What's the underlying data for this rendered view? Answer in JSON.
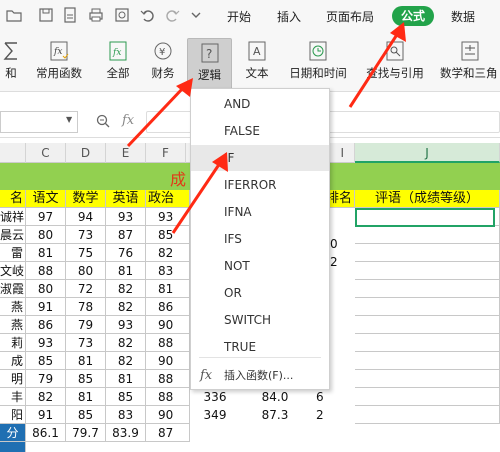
{
  "toolbar": {
    "tabs": [
      "开始",
      "插入",
      "页面布局",
      "公式",
      "数据"
    ],
    "active_tab": "公式",
    "active_color": "#22a34a"
  },
  "ribbon": {
    "buttons": [
      "和",
      "常用函数",
      "全部",
      "财务",
      "逻辑",
      "文本",
      "日期和时间",
      "查找与引用",
      "数学和三角"
    ],
    "pressed": "逻辑"
  },
  "formula_bar": {
    "fx_label": "fx",
    "value": ""
  },
  "sheet": {
    "columns": [
      "C",
      "D",
      "E",
      "F",
      "I",
      "J"
    ],
    "title_char": "成",
    "header_row": [
      "名",
      "语文",
      "数学",
      "英语",
      "政治",
      "排名",
      "评语（成绩等级）"
    ],
    "rows": [
      [
        "诚祥",
        "97",
        "94",
        "93",
        "93"
      ],
      [
        "晨云",
        "80",
        "73",
        "87",
        "85"
      ],
      [
        "雷",
        "81",
        "75",
        "76",
        "82"
      ],
      [
        "文岐",
        "88",
        "80",
        "81",
        "83"
      ],
      [
        "淑霞",
        "80",
        "72",
        "82",
        "81"
      ],
      [
        "燕",
        "91",
        "78",
        "82",
        "86"
      ],
      [
        "燕",
        "86",
        "79",
        "93",
        "90"
      ],
      [
        "莉",
        "93",
        "73",
        "82",
        "88"
      ],
      [
        "成",
        "85",
        "81",
        "82",
        "90"
      ],
      [
        "明",
        "79",
        "85",
        "81",
        "88"
      ],
      [
        "丰",
        "82",
        "81",
        "85",
        "88"
      ],
      [
        "阳",
        "91",
        "85",
        "83",
        "90"
      ]
    ],
    "rank_values": [
      "0",
      "2"
    ],
    "row11_extra": [
      "336",
      "84.0",
      "6"
    ],
    "row12_extra": [
      "349",
      "87.3",
      "2"
    ],
    "avg_row": [
      "分",
      "86.1",
      "79.7",
      "83.9",
      "87"
    ],
    "accent_green": "#92d050",
    "header_yellow": "#ffff00"
  },
  "dropdown": {
    "items": [
      "AND",
      "FALSE",
      "IF",
      "IFERROR",
      "IFNA",
      "IFS",
      "NOT",
      "OR",
      "SWITCH",
      "TRUE"
    ],
    "highlighted": "IF",
    "insert_function": "插入函数(F)...",
    "insert_icon": "fx"
  },
  "annotation_color": "#ff2a14"
}
